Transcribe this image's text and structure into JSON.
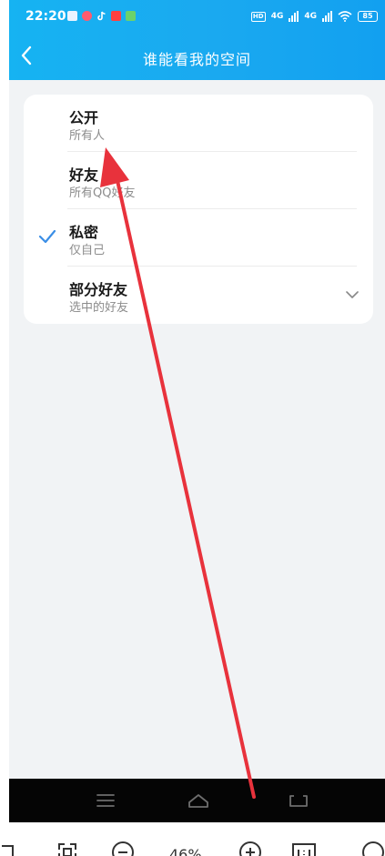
{
  "status_bar": {
    "time": "22:20",
    "network_1": "4G",
    "network_2": "4G",
    "hd": "HD",
    "battery": "85"
  },
  "nav": {
    "title": "谁能看我的空间",
    "back_icon": "chevron-left-icon"
  },
  "options": [
    {
      "title": "公开",
      "subtitle": "所有人",
      "selected": false,
      "expandable": false
    },
    {
      "title": "好友",
      "subtitle": "所有QQ好友",
      "selected": false,
      "expandable": false
    },
    {
      "title": "私密",
      "subtitle": "仅自己",
      "selected": true,
      "expandable": false
    },
    {
      "title": "部分好友",
      "subtitle": "选中的好友",
      "selected": false,
      "expandable": true
    }
  ],
  "viewer_toolbar": {
    "zoom_level": "46%"
  },
  "colors": {
    "header_blue": "#16b3f2",
    "check_blue": "#3a8ee6",
    "annotation_red": "#e8323c"
  }
}
